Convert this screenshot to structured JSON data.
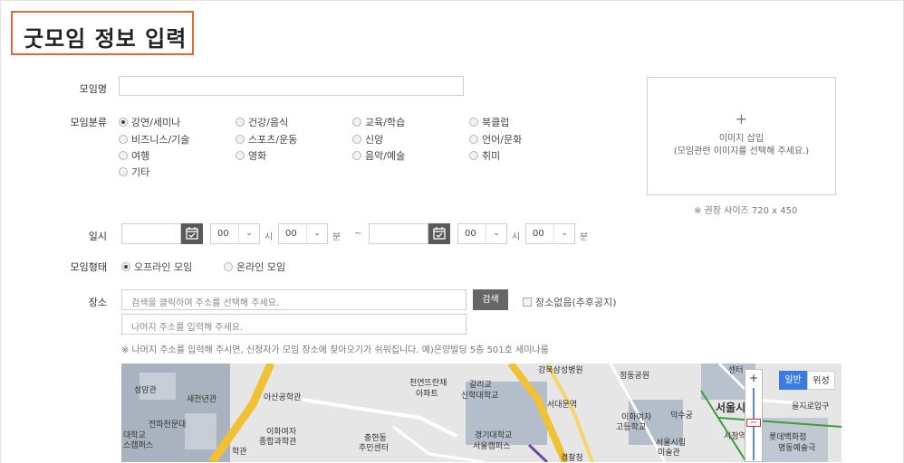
{
  "page_title": "굿모임 정보 입력",
  "fields": {
    "name_label": "모임명",
    "category_label": "모임분류",
    "datetime_label": "일시",
    "type_label": "모임형태",
    "place_label": "장소"
  },
  "categories": [
    {
      "label": "강연/세미나",
      "selected": true
    },
    {
      "label": "건강/음식",
      "selected": false
    },
    {
      "label": "교육/학습",
      "selected": false
    },
    {
      "label": "북클럽",
      "selected": false
    },
    {
      "label": "비즈니스/기술",
      "selected": false
    },
    {
      "label": "스포츠/운동",
      "selected": false
    },
    {
      "label": "신앙",
      "selected": false
    },
    {
      "label": "언어/문화",
      "selected": false
    },
    {
      "label": "여행",
      "selected": false
    },
    {
      "label": "영화",
      "selected": false
    },
    {
      "label": "음악/예술",
      "selected": false
    },
    {
      "label": "취미",
      "selected": false
    },
    {
      "label": "기타",
      "selected": false
    }
  ],
  "image_box": {
    "plus": "+",
    "line1": "이미지 삽입",
    "line2": "(모임관련 이미지를 선택해 주세요.)",
    "size_note": "※ 권장 사이즈 720 x 450"
  },
  "datetime": {
    "start_hour": "00",
    "start_minute": "00",
    "end_hour": "00",
    "end_minute": "00",
    "hour_unit": "시",
    "minute_unit": "분",
    "tilde": "~"
  },
  "meeting_type": {
    "offline": "오프라인 모임",
    "online": "온라인 모임",
    "offline_selected": true
  },
  "place": {
    "search_placeholder": "검색을 클릭하여 주소를 선택해 주세요.",
    "search_button": "검색",
    "no_place_label": "장소없음(추후공지)",
    "detail_placeholder": "나머지 주소를 입력해 주세요.",
    "hint": "※ 나머지 주소를 입력해 주시면, 신청자가 모임 장소에 찾아오기가 쉬워집니다. 예)은양빌딩 5층 501호 세미나룸"
  },
  "map": {
    "type_normal": "일반",
    "type_satellite": "위성",
    "zoom_in": "+",
    "zoom_out": "−",
    "labels": [
      "성암관",
      "새천년관",
      "아산공학관",
      "전파천문대",
      "대학교",
      "스캠퍼스",
      "이화여자",
      "종합과학관",
      "학관",
      "천연뜨란채",
      "아파트",
      "갈리교",
      "신학대학교",
      "충현동",
      "주민센터",
      "경기대학교",
      "서울캠퍼스",
      "강북삼성병원",
      "정동공원",
      "서대문역",
      "이화여자",
      "고등학교",
      "덕수궁",
      "서울시립",
      "미술관",
      "경찰청",
      "센터",
      "서울시",
      "시청역",
      "을지로입구",
      "롯데백화점",
      "명동예술극"
    ]
  }
}
